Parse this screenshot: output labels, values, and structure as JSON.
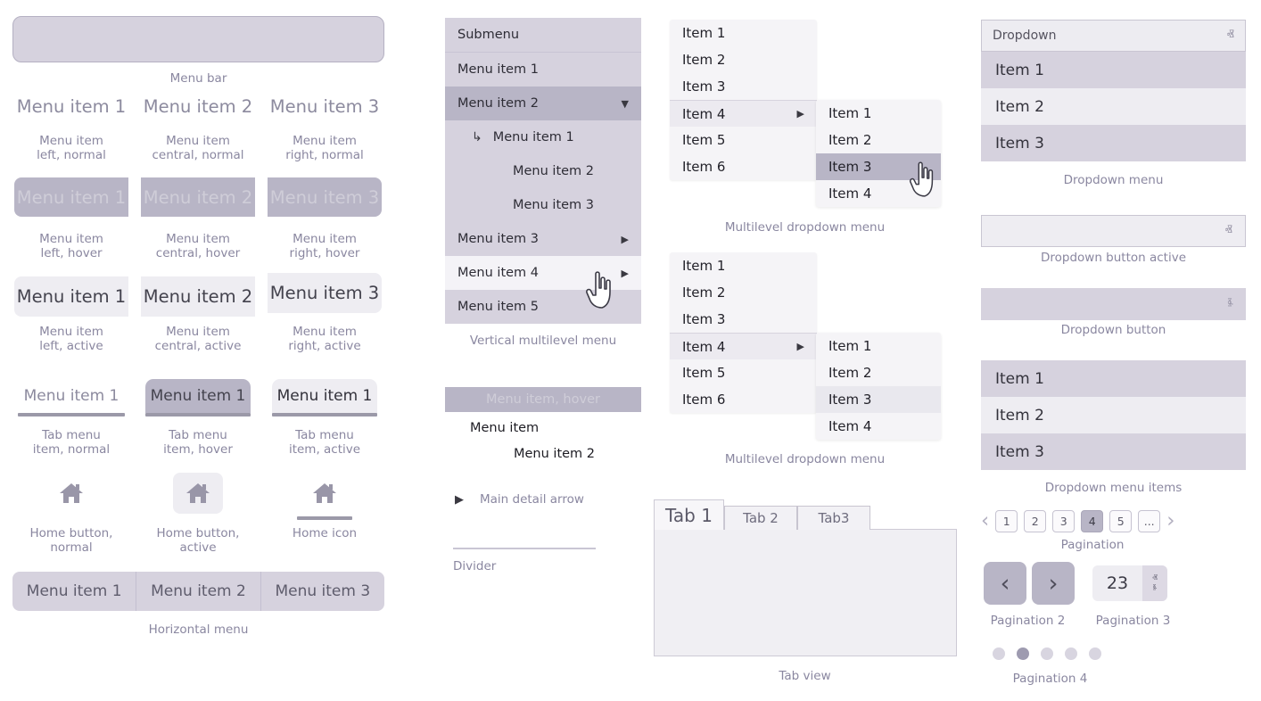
{
  "left": {
    "menu_bar_caption": "Menu bar",
    "normal_items": [
      "Menu item 1",
      "Menu item 2",
      "Menu item 3"
    ],
    "normal_captions": [
      "Menu item\nleft, normal",
      "Menu item\ncentral, normal",
      "Menu item\nright, normal"
    ],
    "hover_items": [
      "Menu item 1",
      "Menu item 2",
      "Menu item 3"
    ],
    "hover_captions": [
      "Menu item\nleft, hover",
      "Menu item\ncentral, hover",
      "Menu item\nright, hover"
    ],
    "active_items": [
      "Menu item 1",
      "Menu item 2",
      "Menu item 3"
    ],
    "active_captions": [
      "Menu item\nleft, active",
      "Menu item\ncentral, active",
      "Menu item\nright, active"
    ],
    "tab_items": [
      "Menu item 1",
      "Menu item 1",
      "Menu item 1"
    ],
    "tab_captions": [
      "Tab menu\nitem, normal",
      "Tab menu\nitem, hover",
      "Tab menu\nitem, active"
    ],
    "home_captions": [
      "Home button,\nnormal",
      "Home button,\nactive",
      "Home icon"
    ],
    "home_icon": "home-icon",
    "horizontal_items": [
      "Menu item 1",
      "Menu item 2",
      "Menu item 3"
    ],
    "horizontal_caption": "Horizontal menu"
  },
  "vertical_menu": {
    "caption": "Vertical multilevel menu",
    "rows": [
      {
        "label": "Submenu",
        "state": "header",
        "caret": ""
      },
      {
        "label": "Menu item 1",
        "state": "normal",
        "caret": ""
      },
      {
        "label": "Menu item 2",
        "state": "selected",
        "caret": "▼"
      },
      {
        "label": "Menu item 1",
        "state": "child-first",
        "caret": ""
      },
      {
        "label": "Menu item 2",
        "state": "child",
        "caret": ""
      },
      {
        "label": "Menu item 3",
        "state": "child",
        "caret": ""
      },
      {
        "label": "Menu item 3",
        "state": "normal",
        "caret": "▶"
      },
      {
        "label": "Menu item 4",
        "state": "hover",
        "caret": "▶"
      },
      {
        "label": "Menu item 5",
        "state": "normal",
        "caret": ""
      }
    ],
    "child_arrow_icon": "corner-down-right-arrow-icon",
    "cursor_icon": "pointing-hand-cursor-icon"
  },
  "col2_extras": {
    "hover_label": "Menu item, hover",
    "plain_label": "Menu item",
    "indent_label": "Menu item 2",
    "arrow_label": "Main detail arrow",
    "arrow_icon": "right-triangle-icon",
    "divider_label": "Divider"
  },
  "multilevel_1": {
    "caption": "Multilevel dropdown menu",
    "level1": [
      "Item 1",
      "Item 2",
      "Item 3",
      "Item 4",
      "Item 5",
      "Item 6"
    ],
    "level1_expanded_index": 3,
    "level2": [
      "Item 1",
      "Item 2",
      "Item 3",
      "Item 4"
    ],
    "level2_highlight_index": 2,
    "level2_highlight_style": "dark",
    "submenu_caret": "▶",
    "cursor_icon": "pointing-hand-cursor-icon"
  },
  "multilevel_2": {
    "caption": "Multilevel dropdown menu",
    "level1": [
      "Item 1",
      "Item 2",
      "Item 3",
      "Item 4",
      "Item 5",
      "Item 6"
    ],
    "level1_expanded_index": 3,
    "level2": [
      "Item 1",
      "Item 2",
      "Item 3",
      "Item 4"
    ],
    "level2_highlight_index": 2,
    "level2_highlight_style": "soft",
    "submenu_caret": "▶"
  },
  "tab_view": {
    "caption": "Tab view",
    "tabs": [
      "Tab 1",
      "Tab 2",
      "Tab3"
    ],
    "selected_index": 0
  },
  "dropdown_menu": {
    "header_label": "Dropdown",
    "chevron_up": "ⱏ",
    "items": [
      "Item 1",
      "Item 2",
      "Item 3"
    ],
    "caption": "Dropdown menu"
  },
  "dropdown_button_active": {
    "caption": "Dropdown button active",
    "chevron": "ⱏ"
  },
  "dropdown_button": {
    "caption": "Dropdown button",
    "chevron": "ⱛ"
  },
  "dropdown_menu_items": {
    "items": [
      "Item 1",
      "Item 2",
      "Item 3"
    ],
    "caption": "Dropdown menu items"
  },
  "pagination": {
    "caption": "Pagination",
    "prev_icon": "chevron-left-icon",
    "next_icon": "chevron-right-icon",
    "prev": "‹",
    "next": "›",
    "pages": [
      "1",
      "2",
      "3",
      "4",
      "5",
      "..."
    ],
    "current_index": 3
  },
  "pagination2": {
    "caption": "Pagination 2",
    "prev": "‹",
    "next": "›"
  },
  "pagination3": {
    "caption": "Pagination 3",
    "value": "23",
    "up": "ⱏ",
    "down": "ⱛ"
  },
  "pagination4": {
    "caption": "Pagination 4",
    "dot_count": 5,
    "active_index": 1
  },
  "colors": {
    "lavender": "#d6d2de",
    "hover": "#b8b5c6",
    "active_light": "#eeedf2",
    "caption_text": "#8a87a0",
    "body_text": "#23222a"
  }
}
